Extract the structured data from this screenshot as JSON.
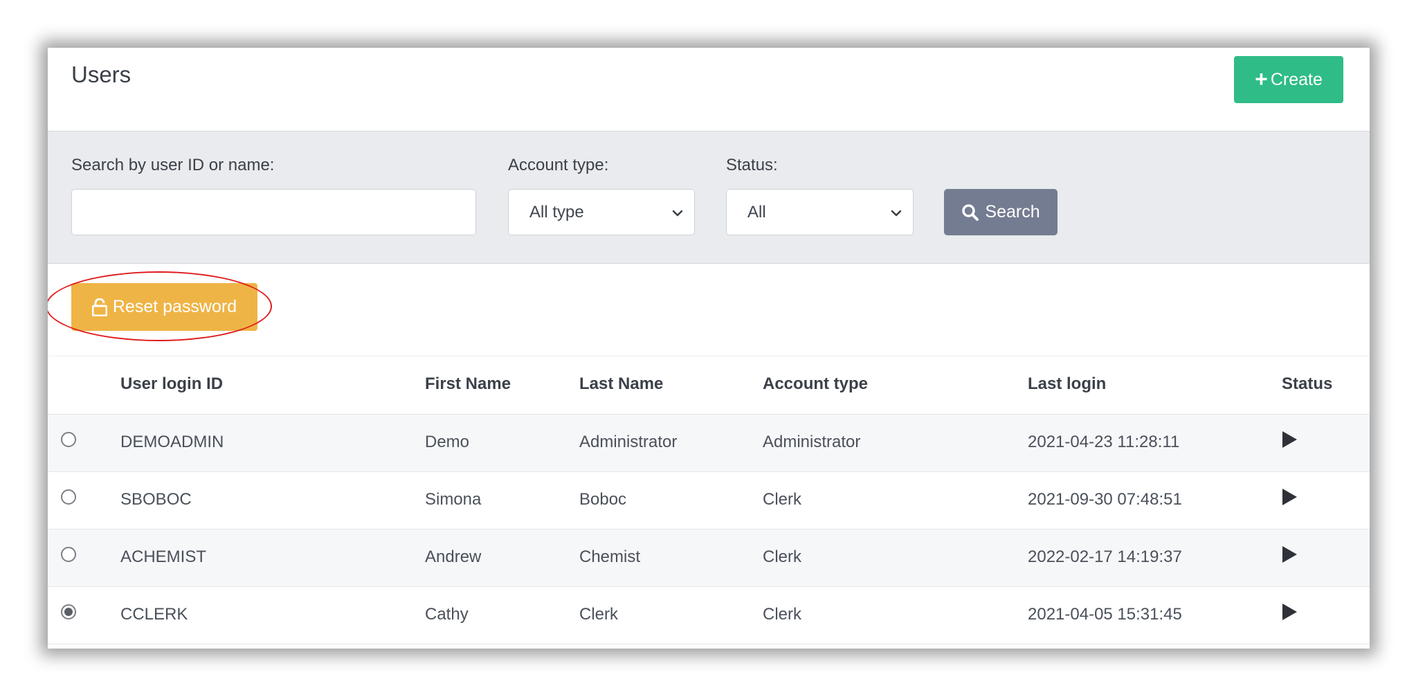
{
  "header": {
    "title": "Users",
    "create_label": "Create",
    "create_icon": "plus-icon"
  },
  "filters": {
    "search_label": "Search by user ID or name:",
    "search_value": "",
    "search_placeholder": "",
    "account_type_label": "Account type:",
    "account_type_value": "All type",
    "status_label": "Status:",
    "status_value": "All",
    "search_button_label": "Search",
    "search_icon": "search-icon"
  },
  "actions": {
    "reset_password_label": "Reset password",
    "reset_icon": "unlock-icon",
    "highlight_color": "#e01b1b"
  },
  "table": {
    "columns": [
      "User login ID",
      "First Name",
      "Last Name",
      "Account type",
      "Last login",
      "Status"
    ],
    "rows": [
      {
        "id": "DEMOADMIN",
        "first": "Demo",
        "last": "Administrator",
        "type": "Administrator",
        "login": "2021-04-23 11:28:11",
        "status_icon": "play-icon",
        "selected": false
      },
      {
        "id": "SBOBOC",
        "first": "Simona",
        "last": "Boboc",
        "type": "Clerk",
        "login": "2021-09-30 07:48:51",
        "status_icon": "play-icon",
        "selected": false
      },
      {
        "id": "ACHEMIST",
        "first": "Andrew",
        "last": "Chemist",
        "type": "Clerk",
        "login": "2022-02-17 14:19:37",
        "status_icon": "play-icon",
        "selected": false
      },
      {
        "id": "CCLERK",
        "first": "Cathy",
        "last": "Clerk",
        "type": "Clerk",
        "login": "2021-04-05 15:31:45",
        "status_icon": "play-icon",
        "selected": true
      }
    ]
  },
  "colors": {
    "create": "#2fbc87",
    "search": "#747c91",
    "reset": "#efb446"
  }
}
